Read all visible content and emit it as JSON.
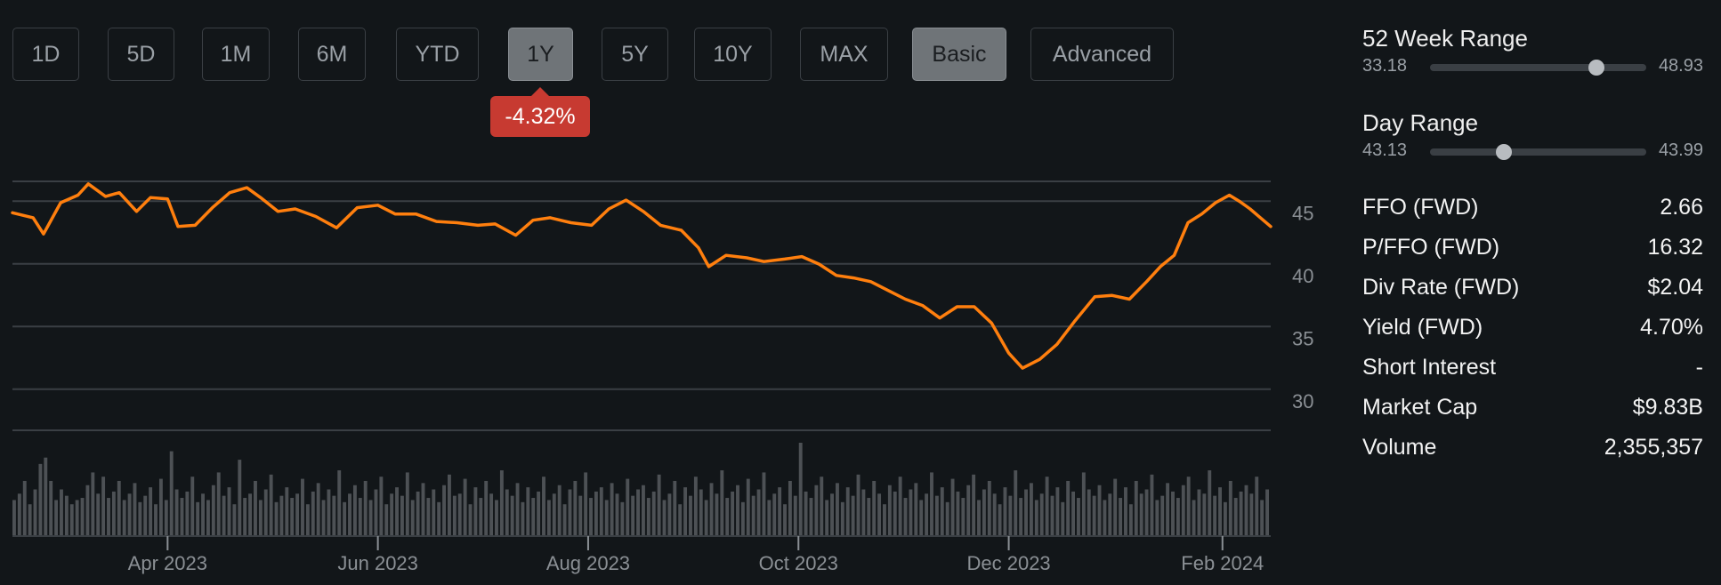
{
  "range_buttons": [
    {
      "label": "1D",
      "active": false
    },
    {
      "label": "5D",
      "active": false
    },
    {
      "label": "1M",
      "active": false
    },
    {
      "label": "6M",
      "active": false
    },
    {
      "label": "YTD",
      "active": false
    },
    {
      "label": "1Y",
      "active": true
    },
    {
      "label": "5Y",
      "active": false
    },
    {
      "label": "10Y",
      "active": false
    },
    {
      "label": "MAX",
      "active": false
    }
  ],
  "mode_buttons": [
    {
      "label": "Basic",
      "active": true
    },
    {
      "label": "Advanced",
      "active": false
    }
  ],
  "change_badge": "-4.32%",
  "stats": {
    "week52": {
      "title": "52 Week Range",
      "low": "33.18",
      "high": "48.93",
      "position": 0.77
    },
    "day": {
      "title": "Day Range",
      "low": "43.13",
      "high": "43.99",
      "position": 0.34
    },
    "rows": [
      {
        "label": "FFO (FWD)",
        "value": "2.66"
      },
      {
        "label": "P/FFO (FWD)",
        "value": "16.32"
      },
      {
        "label": "Div Rate (FWD)",
        "value": "$2.04"
      },
      {
        "label": "Yield (FWD)",
        "value": "4.70%"
      },
      {
        "label": "Short Interest",
        "value": "-"
      },
      {
        "label": "Market Cap",
        "value": "$9.83B"
      },
      {
        "label": "Volume",
        "value": "2,355,357"
      }
    ]
  },
  "colors": {
    "line": "#ff7f0e",
    "grid": "#3a3f44",
    "volume": "#4d5155",
    "badge": "#c73a31"
  },
  "chart_data": {
    "type": "line",
    "title": "",
    "xlabel": "",
    "ylabel": "",
    "ylim": [
      27.5,
      47.5
    ],
    "y_ticks": [
      30,
      35,
      40,
      45
    ],
    "x_range": [
      "2023-02-15",
      "2024-02-15"
    ],
    "x_ticks": [
      {
        "label": "Apr 2023",
        "date": "2023-04-01"
      },
      {
        "label": "Jun 2023",
        "date": "2023-06-01"
      },
      {
        "label": "Aug 2023",
        "date": "2023-08-01"
      },
      {
        "label": "Oct 2023",
        "date": "2023-10-01"
      },
      {
        "label": "Dec 2023",
        "date": "2023-12-01"
      },
      {
        "label": "Feb 2024",
        "date": "2024-02-01"
      }
    ],
    "series": [
      {
        "values": [
          [
            "2023-02-15",
            45.0
          ],
          [
            "2023-02-21",
            44.6
          ],
          [
            "2023-02-24",
            43.3
          ],
          [
            "2023-03-01",
            45.8
          ],
          [
            "2023-03-06",
            46.4
          ],
          [
            "2023-03-09",
            47.3
          ],
          [
            "2023-03-14",
            46.3
          ],
          [
            "2023-03-18",
            46.6
          ],
          [
            "2023-03-23",
            45.1
          ],
          [
            "2023-03-27",
            46.2
          ],
          [
            "2023-04-01",
            46.1
          ],
          [
            "2023-04-04",
            43.9
          ],
          [
            "2023-04-09",
            44.0
          ],
          [
            "2023-04-14",
            45.4
          ],
          [
            "2023-04-19",
            46.6
          ],
          [
            "2023-04-24",
            47.0
          ],
          [
            "2023-04-28",
            46.2
          ],
          [
            "2023-05-03",
            45.1
          ],
          [
            "2023-05-08",
            45.3
          ],
          [
            "2023-05-14",
            44.7
          ],
          [
            "2023-05-20",
            43.8
          ],
          [
            "2023-05-26",
            45.4
          ],
          [
            "2023-06-01",
            45.6
          ],
          [
            "2023-06-06",
            44.9
          ],
          [
            "2023-06-12",
            44.9
          ],
          [
            "2023-06-18",
            44.3
          ],
          [
            "2023-06-24",
            44.2
          ],
          [
            "2023-06-30",
            44.0
          ],
          [
            "2023-07-05",
            44.1
          ],
          [
            "2023-07-11",
            43.2
          ],
          [
            "2023-07-16",
            44.4
          ],
          [
            "2023-07-21",
            44.6
          ],
          [
            "2023-07-27",
            44.2
          ],
          [
            "2023-08-02",
            44.0
          ],
          [
            "2023-08-07",
            45.3
          ],
          [
            "2023-08-12",
            46.0
          ],
          [
            "2023-08-17",
            45.1
          ],
          [
            "2023-08-22",
            44.0
          ],
          [
            "2023-08-28",
            43.6
          ],
          [
            "2023-09-02",
            42.2
          ],
          [
            "2023-09-05",
            40.7
          ],
          [
            "2023-09-10",
            41.6
          ],
          [
            "2023-09-16",
            41.4
          ],
          [
            "2023-09-21",
            41.1
          ],
          [
            "2023-09-27",
            41.3
          ],
          [
            "2023-10-02",
            41.5
          ],
          [
            "2023-10-07",
            40.9
          ],
          [
            "2023-10-12",
            40.0
          ],
          [
            "2023-10-17",
            39.8
          ],
          [
            "2023-10-22",
            39.5
          ],
          [
            "2023-10-27",
            38.8
          ],
          [
            "2023-11-01",
            38.1
          ],
          [
            "2023-11-06",
            37.6
          ],
          [
            "2023-11-11",
            36.6
          ],
          [
            "2023-11-16",
            37.5
          ],
          [
            "2023-11-21",
            37.5
          ],
          [
            "2023-11-26",
            36.2
          ],
          [
            "2023-12-01",
            33.8
          ],
          [
            "2023-12-05",
            32.6
          ],
          [
            "2023-12-10",
            33.3
          ],
          [
            "2023-12-15",
            34.5
          ],
          [
            "2023-12-20",
            36.3
          ],
          [
            "2023-12-26",
            38.3
          ],
          [
            "2023-12-31",
            38.4
          ],
          [
            "2024-01-05",
            38.1
          ],
          [
            "2024-01-10",
            39.5
          ],
          [
            "2024-01-14",
            40.7
          ],
          [
            "2024-01-18",
            41.6
          ],
          [
            "2024-01-22",
            44.2
          ],
          [
            "2024-01-26",
            44.9
          ],
          [
            "2024-01-30",
            45.8
          ],
          [
            "2024-02-03",
            46.4
          ],
          [
            "2024-02-06",
            45.9
          ],
          [
            "2024-02-09",
            45.3
          ],
          [
            "2024-02-12",
            44.6
          ],
          [
            "2024-02-15",
            43.9
          ]
        ]
      }
    ],
    "volume": [
      34,
      40,
      52,
      30,
      44,
      68,
      74,
      52,
      34,
      44,
      38,
      30,
      34,
      36,
      48,
      60,
      40,
      56,
      36,
      42,
      52,
      34,
      40,
      50,
      32,
      38,
      46,
      30,
      54,
      34,
      80,
      44,
      36,
      42,
      56,
      32,
      40,
      34,
      48,
      60,
      38,
      46,
      30,
      72,
      36,
      40,
      52,
      34,
      44,
      58,
      32,
      38,
      46,
      36,
      40,
      54,
      30,
      42,
      50,
      34,
      44,
      38,
      62,
      32,
      40,
      48,
      36,
      52,
      34,
      44,
      56,
      30,
      40,
      46,
      38,
      60,
      34,
      42,
      50,
      36,
      44,
      32,
      48,
      58,
      38,
      40,
      54,
      30,
      46,
      36,
      52,
      40,
      34,
      62,
      44,
      38,
      50,
      32,
      46,
      36,
      42,
      56,
      34,
      40,
      48,
      30,
      44,
      52,
      38,
      60,
      36,
      42,
      46,
      34,
      50,
      40,
      32,
      54,
      38,
      44,
      48,
      36,
      42,
      58,
      34,
      40,
      52,
      30,
      46,
      38,
      56,
      44,
      34,
      50,
      40,
      62,
      36,
      42,
      48,
      32,
      54,
      38,
      44,
      60,
      34,
      40,
      46,
      30,
      52,
      38,
      88,
      42,
      36,
      48,
      56,
      34,
      40,
      50,
      32,
      46,
      38,
      58,
      44,
      36,
      52,
      40,
      30,
      48,
      42,
      56,
      36,
      44,
      50,
      34,
      40,
      60,
      38,
      46,
      32,
      54,
      42,
      36,
      48,
      58,
      34,
      44,
      52,
      40,
      30,
      46,
      38,
      62,
      36,
      44,
      50,
      34,
      40,
      56,
      38,
      46,
      32,
      52,
      42,
      36,
      60,
      44,
      38,
      48,
      34,
      40,
      54,
      36,
      46,
      30,
      52,
      40,
      44,
      58,
      34,
      38,
      50,
      42,
      36,
      48,
      56,
      34,
      44,
      40,
      62,
      38,
      46,
      32,
      52,
      36,
      42,
      48,
      40,
      56,
      34,
      44
    ]
  }
}
